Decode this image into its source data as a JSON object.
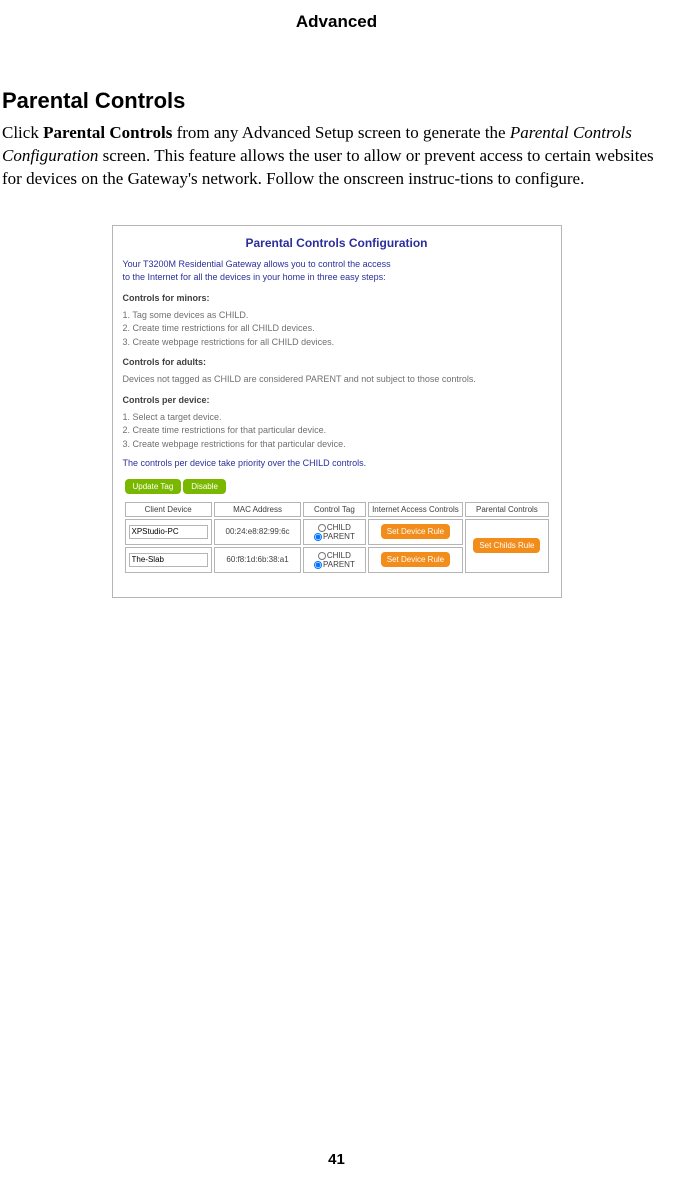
{
  "header": {
    "title": "Advanced"
  },
  "section": {
    "title": "Parental Controls"
  },
  "body": {
    "prefix": "Click ",
    "bold1": "Parental Controls",
    "mid1": " from any Advanced Setup screen to generate the ",
    "italic1": "Parental Controls Configuration",
    "rest": " screen. This feature allows the user to allow or prevent access to certain websites for devices on the Gateway's network. Follow the onscreen instruc-tions to configure."
  },
  "config": {
    "title": "Parental Controls Configuration",
    "intro_line1": "Your T3200M Residential Gateway allows you to control the access",
    "intro_line2": "to the Internet for all the devices in your home in three easy steps:",
    "minors_heading": "Controls for minors:",
    "minors_step1": "1. Tag some devices as CHILD.",
    "minors_step2": "2. Create time restrictions for all CHILD devices.",
    "minors_step3": "3. Create webpage restrictions for all CHILD devices.",
    "adults_heading": "Controls for adults:",
    "adults_line": "Devices not tagged as CHILD are considered PARENT and not subject to those controls.",
    "perdevice_heading": "Controls per device:",
    "perdevice_step1": "1. Select a target device.",
    "perdevice_step2": "2. Create time restrictions for that particular device.",
    "perdevice_step3": "3. Create webpage restrictions for that particular device.",
    "priority_line": "The controls per device take priority over the CHILD controls.",
    "buttons": {
      "update_tag": "Update Tag",
      "disable": "Disable"
    },
    "table": {
      "headers": {
        "client": "Client Device",
        "mac": "MAC Address",
        "tag": "Control Tag",
        "iac": "Internet Access Controls",
        "parental": "Parental Controls"
      },
      "tag_opts": {
        "child": "CHILD",
        "parent": "PARENT"
      },
      "rows": [
        {
          "client": "XPStudio-PC",
          "mac": "00:24:e8:82:99:6c",
          "tag_selected": "PARENT",
          "iac_btn": "Set Device Rule"
        },
        {
          "client": "The-Slab",
          "mac": "60:f8:1d:6b:38:a1",
          "tag_selected": "PARENT",
          "iac_btn": "Set Device Rule"
        }
      ],
      "parental_btn": "Set Childs Rule"
    }
  },
  "page_number": "41"
}
